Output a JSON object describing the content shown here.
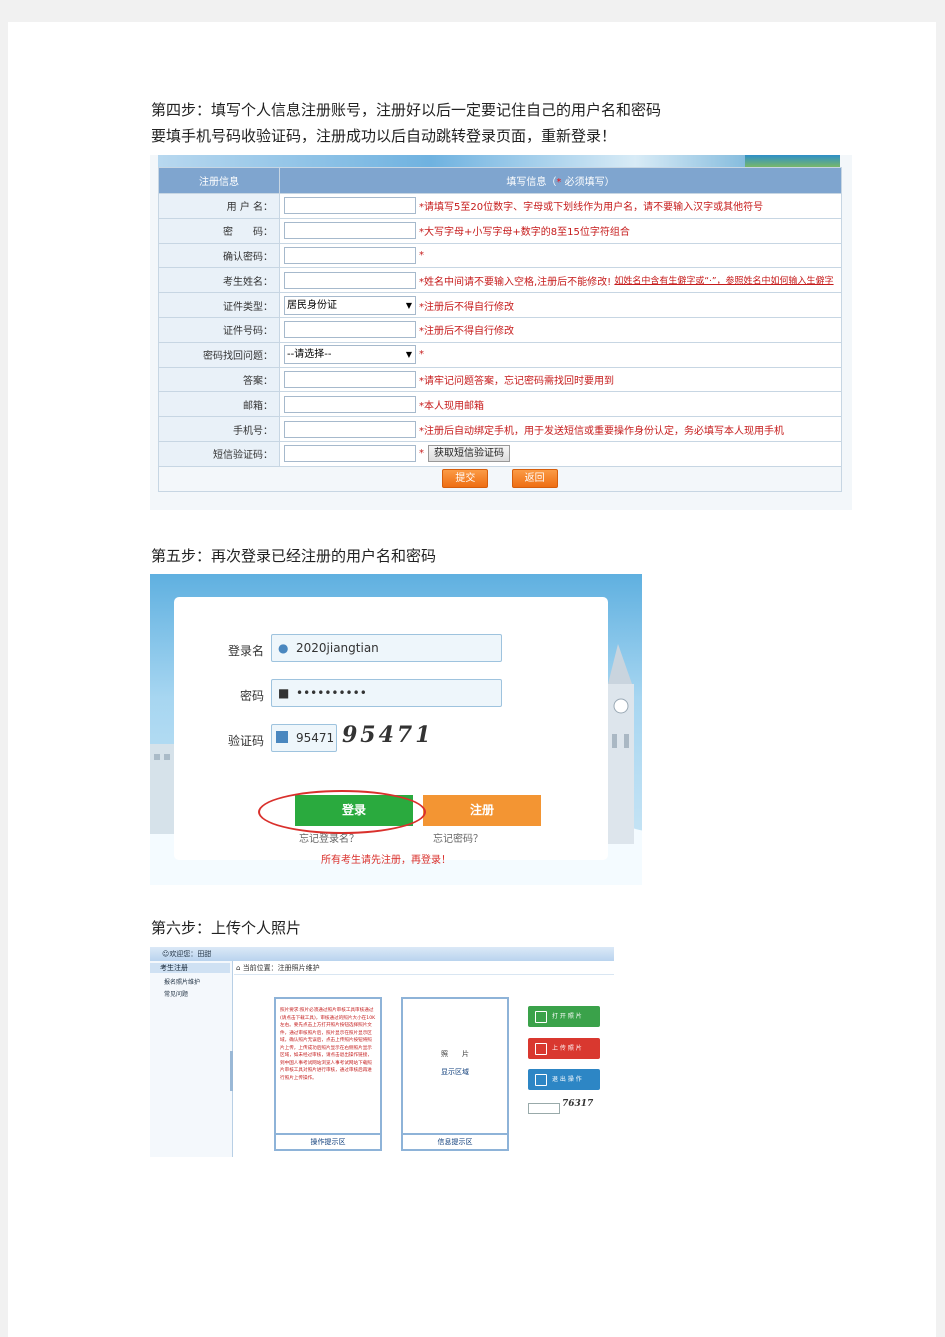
{
  "steps": {
    "step4_line1": "第四步：填写个人信息注册账号，注册好以后一定要记住自己的用户名和密码",
    "step4_line2": "要填手机号码收验证码，注册成功以后自动跳转登录页面，重新登录！",
    "step5": "第五步：再次登录已经注册的用户名和密码",
    "step6": "第六步：上传个人照片"
  },
  "register_form": {
    "header": {
      "col1": "注册信息",
      "col2_prefix": "填写信息（",
      "col2_star": "*",
      "col2_suffix": " 必须填写）"
    },
    "rows": [
      {
        "label": "用 户 名：",
        "type": "input",
        "hint": "*请填写5至20位数字、字母或下划线作为用户名，请不要输入汉字或其他符号"
      },
      {
        "label": "密　　码：",
        "type": "input",
        "hint": "*大写字母+小写字母+数字的8至15位字符组合"
      },
      {
        "label": "确认密码：",
        "type": "input",
        "hint": "*"
      },
      {
        "label": "考生姓名：",
        "type": "input",
        "hint": "*姓名中间请不要输入空格,注册后不能修改!",
        "hint_link": "如姓名中含有生僻字或“·”，参照姓名中如何输入生僻字"
      },
      {
        "label": "证件类型：",
        "type": "select",
        "value": "居民身份证",
        "hint": "*注册后不得自行修改"
      },
      {
        "label": "证件号码：",
        "type": "input",
        "hint": "*注册后不得自行修改"
      },
      {
        "label": "密码找回问题：",
        "type": "select",
        "value": "--请选择--",
        "hint": "*"
      },
      {
        "label": "答案：",
        "type": "input",
        "hint": "*请牢记问题答案，忘记密码需找回时要用到"
      },
      {
        "label": "邮箱：",
        "type": "input",
        "hint": "*本人现用邮箱"
      },
      {
        "label": "手机号：",
        "type": "input",
        "hint": "*注册后自动绑定手机，用于发送短信或重要操作身份认定，务必填写本人现用手机"
      },
      {
        "label": "短信验证码：",
        "type": "sms",
        "hint": "*",
        "button": "获取短信验证码"
      }
    ],
    "submit_label": "提交",
    "back_label": "返回"
  },
  "login": {
    "username_label": "登录名",
    "username_value": "2020jiangtian",
    "password_label": "密码",
    "password_value": "••••••••••",
    "captcha_label": "验证码",
    "captcha_value": "95471",
    "captcha_image_text": "95471",
    "login_button": "登录",
    "register_button": "注册",
    "forgot_username": "忘记登录名？",
    "forgot_password": "忘记密码？",
    "notice": "所有考生请先注册，再登录！"
  },
  "upload": {
    "welcome": "欢迎您：",
    "user": "田甜",
    "sidebar_title": "考生注册",
    "sidebar_items": [
      "报名照片维护",
      "常见问题"
    ],
    "breadcrumb": "当前位置：注册照片维护",
    "notice_text": "照片要求:照片必须通过照片审核工具审核通过(请点击下载工具)，审核通过的照片大小在10K左右。要先点击上方打开照片按钮选择照片文件，通过审核照片后，照片显示在照片显示区域，确认照片无误后，点击上传照片按钮将照片上传，上传成功后照片显示在右侧照片显示区域，如未经过审核，请点击退出操作链接，到中国人事考试网站浏览人事考试网站下载照片审核工具对照片进行审核，通过审核后再进行照片上传操作。",
    "op_area": "操作提示区",
    "photo_label": "照　　片",
    "photo_sub": "显示区域",
    "info_area": "信息提示区",
    "btn_open": "打 开 照 片",
    "btn_upload": "上 传 照 片",
    "btn_exit": "退 出 操 作",
    "captcha_text": "76317",
    "colors": {
      "open": "#3aa24a",
      "upload": "#d9382f",
      "exit": "#2d86c5"
    }
  }
}
